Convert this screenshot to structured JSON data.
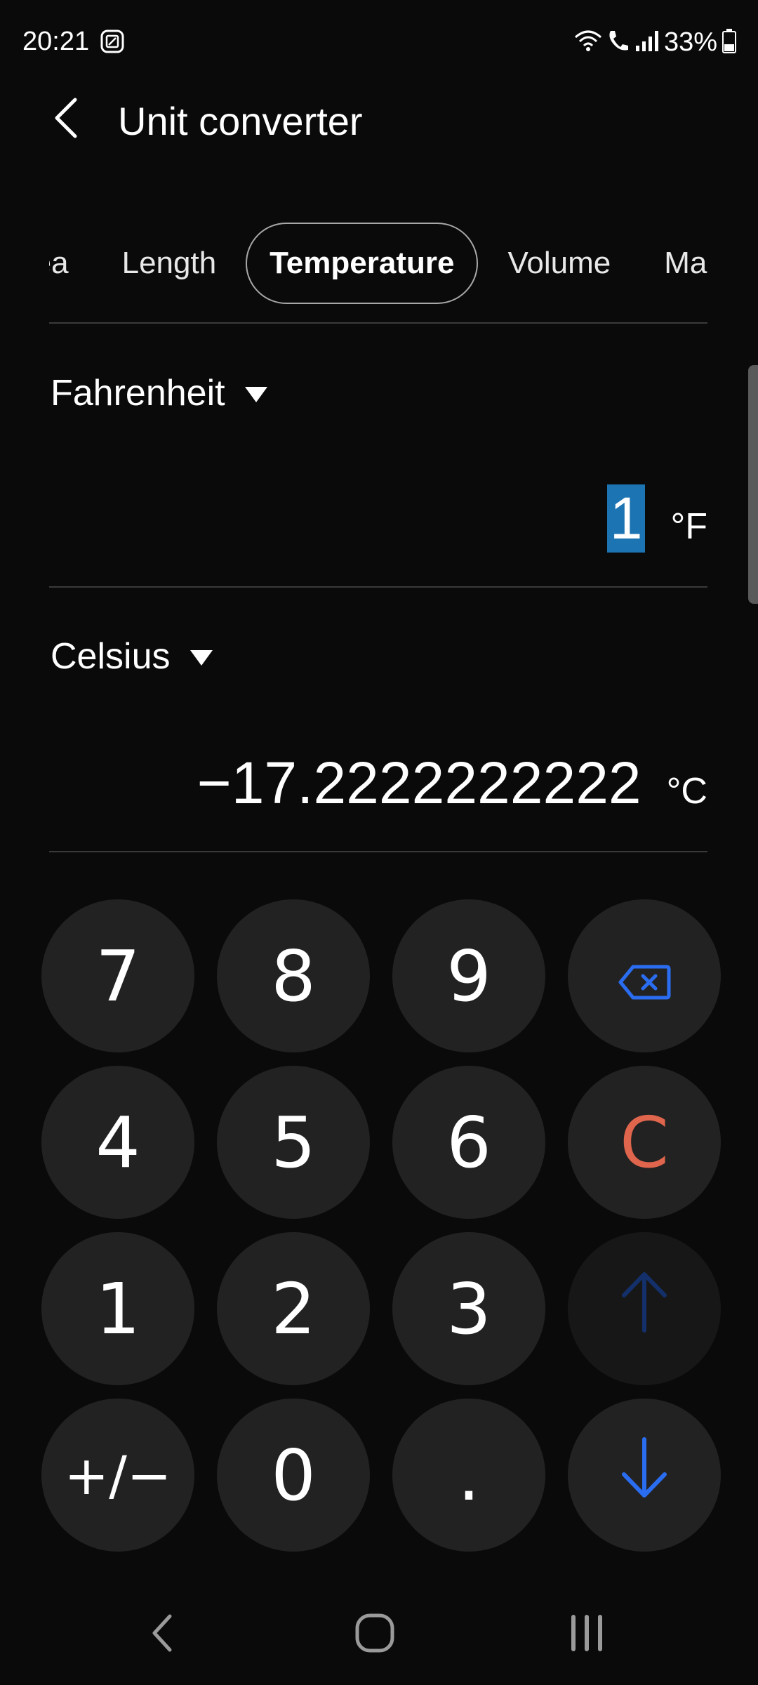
{
  "status_bar": {
    "time": "20:21",
    "battery": "33%",
    "icons": [
      "screenshot-notification-icon",
      "wifi-icon",
      "wifi-calling-icon",
      "signal-icon",
      "battery-icon"
    ]
  },
  "header": {
    "title": "Unit converter",
    "back_icon": "chevron-left-icon"
  },
  "tabs": [
    {
      "label": "rea",
      "active": false
    },
    {
      "label": "Length",
      "active": false
    },
    {
      "label": "Temperature",
      "active": true
    },
    {
      "label": "Volume",
      "active": false
    },
    {
      "label": "Ma",
      "active": false
    }
  ],
  "from": {
    "unit": "Fahrenheit",
    "value": "1",
    "suffix": "°F"
  },
  "to": {
    "unit": "Celsius",
    "value": "−17.2222222222",
    "suffix": "°C"
  },
  "keypad": {
    "row1": [
      "7",
      "8",
      "9"
    ],
    "row2": [
      "4",
      "5",
      "6"
    ],
    "row3": [
      "1",
      "2",
      "3"
    ],
    "row4": [
      "+/−",
      "0",
      "."
    ],
    "backspace_icon": "backspace-icon",
    "clear": "C",
    "up_icon": "arrow-up-icon",
    "down_icon": "arrow-down-icon"
  },
  "colors": {
    "background": "#0a0a0a",
    "key": "#222222",
    "accent_blue": "#2a6df0",
    "clear_red": "#e0654d",
    "selection": "#1d74b3"
  }
}
